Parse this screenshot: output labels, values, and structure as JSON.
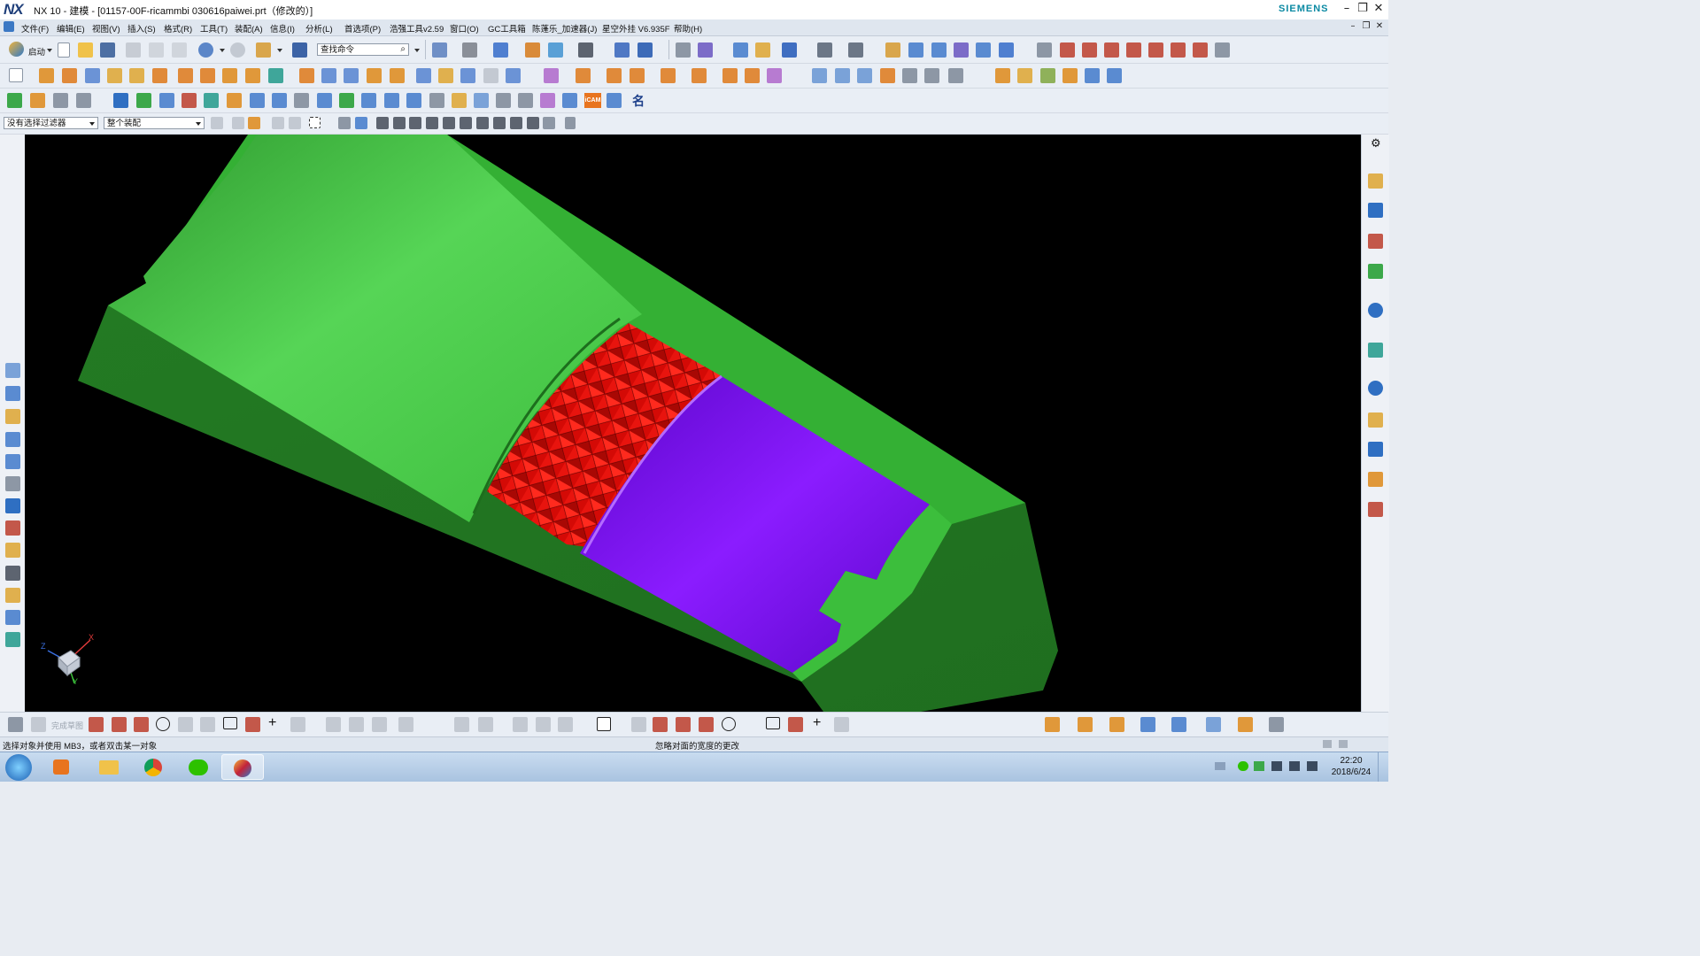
{
  "window": {
    "logo": "NX",
    "title": "NX 10 - 建模 - [01157-00F-ricammbi 030616paiwei.prt（修改的）]",
    "brand": "SIEMENS"
  },
  "menu": [
    "文件(F)",
    "编辑(E)",
    "视图(V)",
    "插入(S)",
    "格式(R)",
    "工具(T)",
    "装配(A)",
    "信息(I)",
    "分析(L)",
    "首选项(P)",
    "浩强工具v2.59",
    "窗口(O)",
    "GC工具箱",
    "陈蓬乐_加速器(J)",
    "星空外挂 V6.935F",
    "帮助(H)"
  ],
  "toolbar": {
    "start_label": "启动",
    "command_search_placeholder": "查找命令",
    "icam_label": "iCAM",
    "name_glyph": "名"
  },
  "selection": {
    "filter_value": "没有选择过滤器",
    "scope_value": "整个装配"
  },
  "sketch_bar": {
    "finish_label": "完成草图"
  },
  "status": {
    "prompt": "选择对象并使用 MB3，或者双击某一对象",
    "message": "忽略对面的宽度的更改"
  },
  "taskbar": {
    "time": "22:20",
    "date": "2018/6/24"
  },
  "triad": {
    "x": "X",
    "y": "Y",
    "z": "Z"
  },
  "colors": {
    "part_green": "#3fc23f",
    "cut_face_purple": "#7b12f0",
    "knurl_red": "#e8120c",
    "background": "#000000"
  }
}
